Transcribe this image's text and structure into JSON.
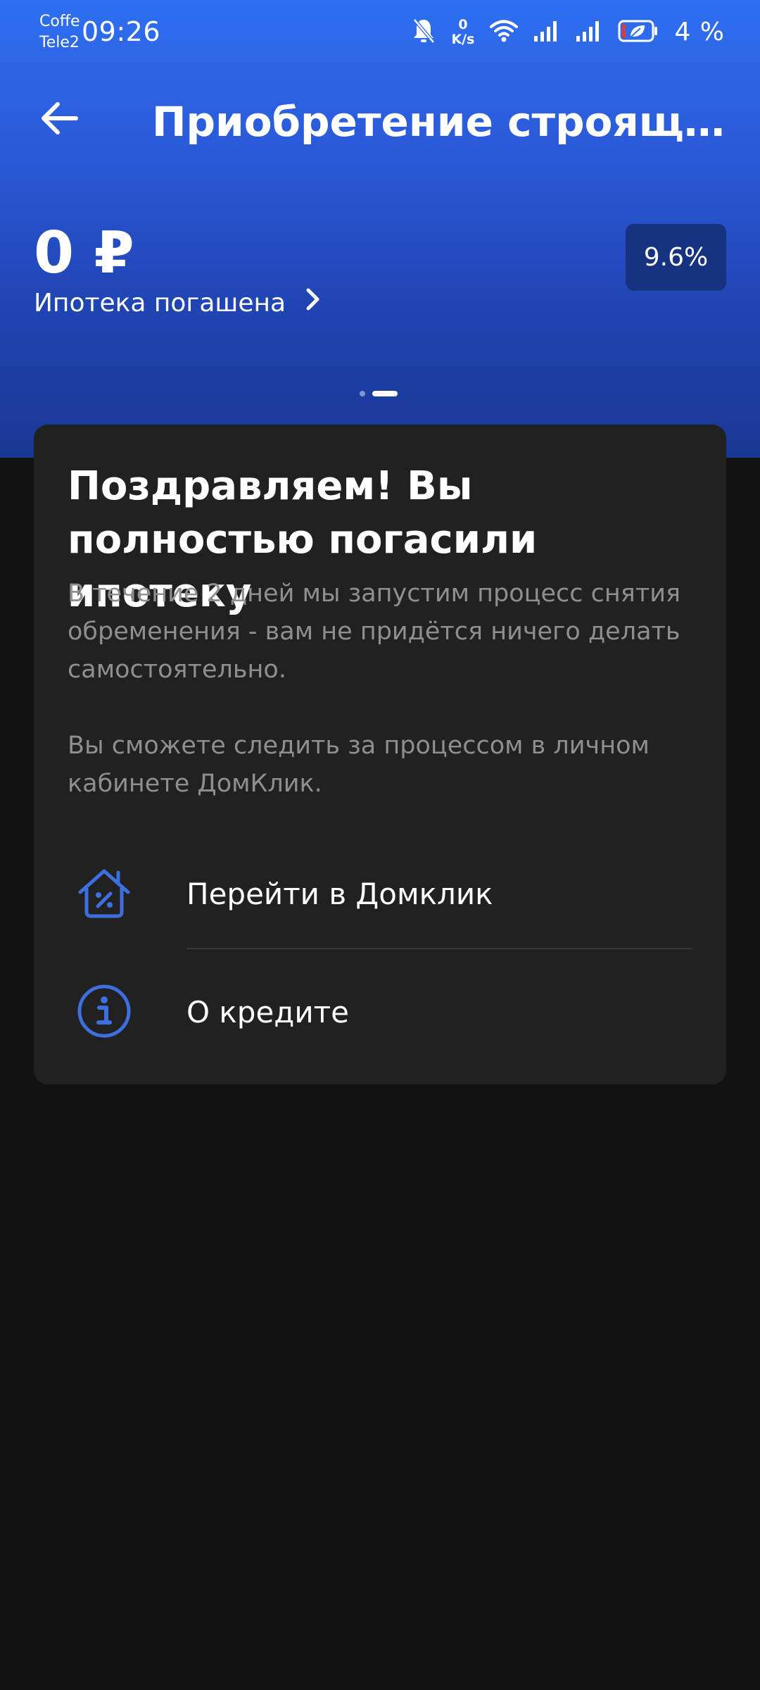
{
  "status_bar": {
    "carrier_1": "Coffe",
    "carrier_2": "Tele2",
    "time": "09:26",
    "net_speed_value": "0",
    "net_speed_unit": "K/s",
    "battery_percent": "4 %"
  },
  "header": {
    "title": "Приобретение строящегос..."
  },
  "loan": {
    "balance": "0 ₽",
    "status_label": "Ипотека погашена",
    "rate": "9.6%"
  },
  "pager": {
    "total": 2,
    "active_index": 1
  },
  "card": {
    "title": "Поздравляем! Вы полностью погасили ипотеку",
    "paragraph_1": "В течение 2 дней мы запустим процесс снятия обременения - вам не придётся ничего делать самостоятельно.",
    "paragraph_2": "Вы сможете следить за процессом в личном кабинете ДомКлик.",
    "actions": [
      {
        "label": "Перейти в Домклик",
        "icon": "house-percent-icon"
      },
      {
        "label": "О кредите",
        "icon": "info-icon"
      }
    ]
  },
  "colors": {
    "header_gradient_top": "#2f6ff2",
    "header_gradient_bottom": "#193893",
    "background": "#121212",
    "card_background": "#212121",
    "accent_icon": "#3e6fe0",
    "muted_text": "#8f8f8f",
    "rate_badge_background": "#163280"
  }
}
